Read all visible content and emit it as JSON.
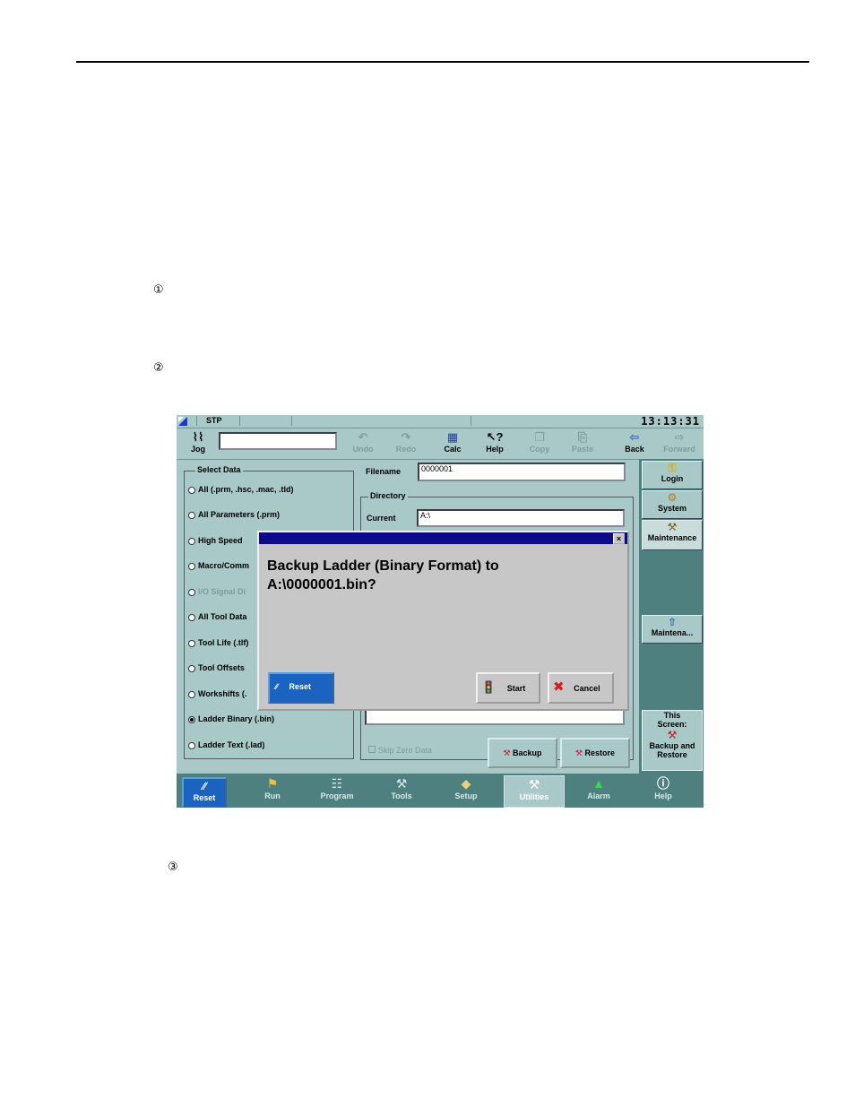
{
  "document": {
    "markers": [
      "①",
      "②",
      "③"
    ]
  },
  "screen": {
    "status": {
      "mode": "STP",
      "clock": "13:13:31"
    },
    "toolbar": {
      "jog_label": "Jog",
      "jog_value": "",
      "undo_label": "Undo",
      "redo_label": "Redo",
      "calc_label": "Calc",
      "help_label": "Help",
      "copy_label": "Copy",
      "paste_label": "Paste",
      "back_label": "Back",
      "forward_label": "Forward"
    },
    "select_data": {
      "legend": "Select Data",
      "options": [
        "All (.prm, .hsc, .mac, .tld)",
        "All Parameters (.prm)",
        "High Speed",
        "Macro/Comm",
        "I/O Signal Di",
        "All Tool Data",
        "Tool Life (.tlf)",
        "Tool Offsets",
        "Workshifts (.",
        "Ladder Binary (.bin)",
        "Ladder Text (.lad)"
      ],
      "selected": "Ladder Binary (.bin)"
    },
    "filename_label": "Filename",
    "filename_value": "0000001",
    "directory_legend": "Directory",
    "current_label": "Current",
    "current_value": "A:\\",
    "skip_zero_label": "Skip Zero Data",
    "backup_button": "Backup",
    "restore_button": "Restore",
    "right_nav": {
      "login": "Login",
      "system": "System",
      "maintenance": "Maintenance",
      "maintenance_sub": "Maintena...",
      "this_screen_line1": "This",
      "this_screen_line2": "Screen:",
      "this_screen_name1": "Backup and",
      "this_screen_name2": "Restore"
    },
    "dialog": {
      "close": "×",
      "message_line1": "Backup Ladder (Binary Format) to",
      "message_line2": "A:\\0000001.bin?",
      "reset_button": "Reset",
      "start_button": "Start",
      "cancel_button": "Cancel"
    },
    "bottom_bar": {
      "reset": "Reset",
      "run": "Run",
      "program": "Program",
      "tools": "Tools",
      "setup": "Setup",
      "utilities": "Utilities",
      "alarm": "Alarm",
      "help": "Help"
    },
    "icons": {
      "jog": "jog-icon",
      "undo": "undo-icon",
      "redo": "redo-icon",
      "calc": "calc-icon",
      "help": "help-icon",
      "copy": "copy-icon",
      "paste": "paste-icon",
      "back": "back-arrow-icon",
      "forward": "forward-arrow-icon",
      "login": "key-icon",
      "system": "system-icon",
      "maintenance": "maintenance-icon",
      "start": "traffic-light-icon",
      "cancel": "red-x-icon"
    },
    "colors": {
      "panel": "#a9c8c8",
      "nav": "#4f8080",
      "titlebar": "#0a0a8a",
      "reset_button": "#1a63c0"
    }
  }
}
